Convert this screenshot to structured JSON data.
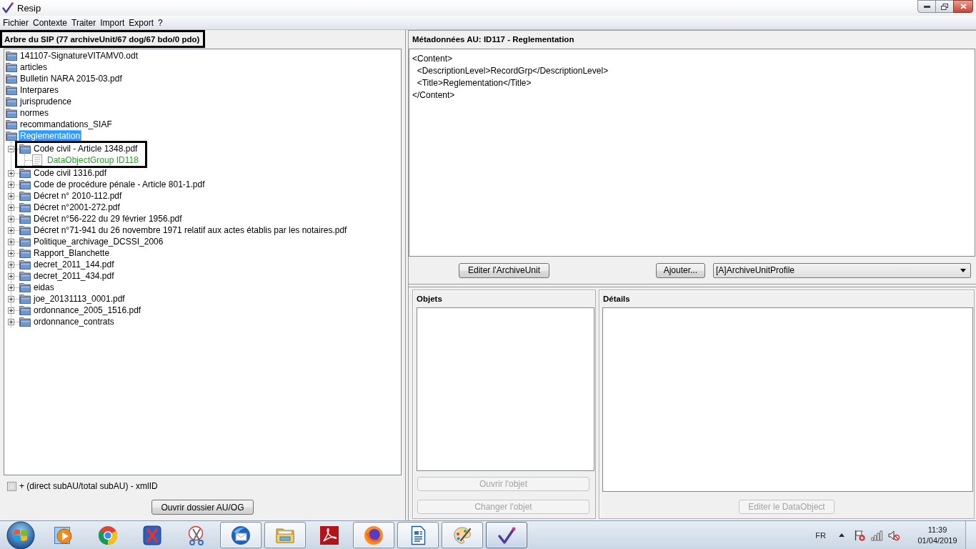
{
  "window": {
    "title": "Resip"
  },
  "menu": [
    "Fichier",
    "Contexte",
    "Traiter",
    "Import",
    "Export",
    "?"
  ],
  "tree_panel": {
    "title": "Arbre du SIP (77 archiveUnit/67 dog/67 bdo/0 pdo)",
    "highlighted": true,
    "items": [
      {
        "label": "141107-SignatureVITAMV0.odt",
        "kind": "folder",
        "selected": false
      },
      {
        "label": "articles",
        "kind": "folder",
        "selected": false
      },
      {
        "label": "Bulletin NARA 2015-03.pdf",
        "kind": "folder",
        "selected": false
      },
      {
        "label": "Interpares",
        "kind": "folder",
        "selected": false
      },
      {
        "label": "jurisprudence",
        "kind": "folder",
        "selected": false
      },
      {
        "label": "normes",
        "kind": "folder",
        "selected": false
      },
      {
        "label": "recommandations_SIAF",
        "kind": "folder",
        "selected": false
      },
      {
        "label": "Reglementation",
        "kind": "folder",
        "selected": true,
        "children": [
          {
            "label": "Code civil - Article 1348.pdf",
            "kind": "folder",
            "selected": false,
            "expanded": true,
            "highlighted": true,
            "children": [
              {
                "label": "DataObjectGroup ID118",
                "kind": "object_group",
                "selected": false
              }
            ]
          },
          {
            "label": "Code civil 1316.pdf",
            "kind": "folder",
            "selected": false,
            "expanded": false,
            "highlighted": false
          },
          {
            "label": "Code de procédure pénale - Article 801-1.pdf",
            "kind": "folder",
            "selected": false,
            "expanded": false,
            "highlighted": false
          },
          {
            "label": "Décret n° 2010-112.pdf",
            "kind": "folder",
            "selected": false,
            "expanded": false,
            "highlighted": false
          },
          {
            "label": "Décret n°2001-272.pdf",
            "kind": "folder",
            "selected": false,
            "expanded": false,
            "highlighted": false
          },
          {
            "label": "Décret n°56-222 du 29 février 1956.pdf",
            "kind": "folder",
            "selected": false,
            "expanded": false,
            "highlighted": false
          },
          {
            "label": "Décret n°71-941 du 26 novembre 1971 relatif aux actes établis par les notaires.pdf",
            "kind": "folder",
            "selected": false,
            "expanded": false,
            "highlighted": false
          },
          {
            "label": "Politique_archivage_DCSSI_2006",
            "kind": "folder",
            "selected": false,
            "expanded": false,
            "highlighted": false
          },
          {
            "label": "Rapport_Blanchette",
            "kind": "folder",
            "selected": false,
            "expanded": false,
            "highlighted": false
          },
          {
            "label": "decret_2011_144.pdf",
            "kind": "folder",
            "selected": false,
            "expanded": false,
            "highlighted": false
          },
          {
            "label": "decret_2011_434.pdf",
            "kind": "folder",
            "selected": false,
            "expanded": false,
            "highlighted": false
          },
          {
            "label": "eidas",
            "kind": "folder",
            "selected": false,
            "expanded": false,
            "highlighted": false
          },
          {
            "label": "joe_20131113_0001.pdf",
            "kind": "folder",
            "selected": false,
            "expanded": false,
            "highlighted": false
          },
          {
            "label": "ordonnance_2005_1516.pdf",
            "kind": "folder",
            "selected": false,
            "expanded": false,
            "highlighted": false
          },
          {
            "label": "ordonnance_contrats",
            "kind": "folder",
            "selected": false,
            "expanded": false,
            "highlighted": false
          }
        ]
      }
    ],
    "option": {
      "label": "+ (direct subAU/total subAU) - xmlID",
      "checked": false
    },
    "button": {
      "label": "Ouvrir dossier AU/OG",
      "disabled": false
    }
  },
  "metadata_panel": {
    "title": "Métadonnées AU: ID117 - Reglementation",
    "content_lines": [
      "<Content>",
      "  <DescriptionLevel>RecordGrp</DescriptionLevel>",
      "  <Title>Reglementation</Title>",
      "</Content>"
    ],
    "edit_button": {
      "label": "Editer l'ArchiveUnit",
      "disabled": false
    },
    "add_button": {
      "label": "Ajouter...",
      "disabled": false
    },
    "profile_select": {
      "value": "[A]ArchiveUnitProfile"
    }
  },
  "objects_panel": {
    "title": "Objets",
    "buttons": [
      {
        "label": "Ouvrir l'objet",
        "disabled": true
      },
      {
        "label": "Changer l'objet",
        "disabled": true
      }
    ]
  },
  "details_panel": {
    "title": "Détails",
    "button": {
      "label": "Editer le DataObject",
      "disabled": true
    }
  },
  "taskbar": {
    "apps": [
      {
        "running": false,
        "selected": false
      },
      {
        "running": false,
        "selected": false
      },
      {
        "running": false,
        "selected": false
      },
      {
        "running": false,
        "selected": false
      },
      {
        "running": true,
        "selected": false
      },
      {
        "running": true,
        "selected": false
      },
      {
        "running": false,
        "selected": false
      },
      {
        "running": true,
        "selected": false
      },
      {
        "running": true,
        "selected": false
      },
      {
        "running": true,
        "selected": false
      },
      {
        "running": true,
        "selected": true
      }
    ],
    "language": "FR",
    "time": "11:39",
    "date": "01/04/2019"
  }
}
